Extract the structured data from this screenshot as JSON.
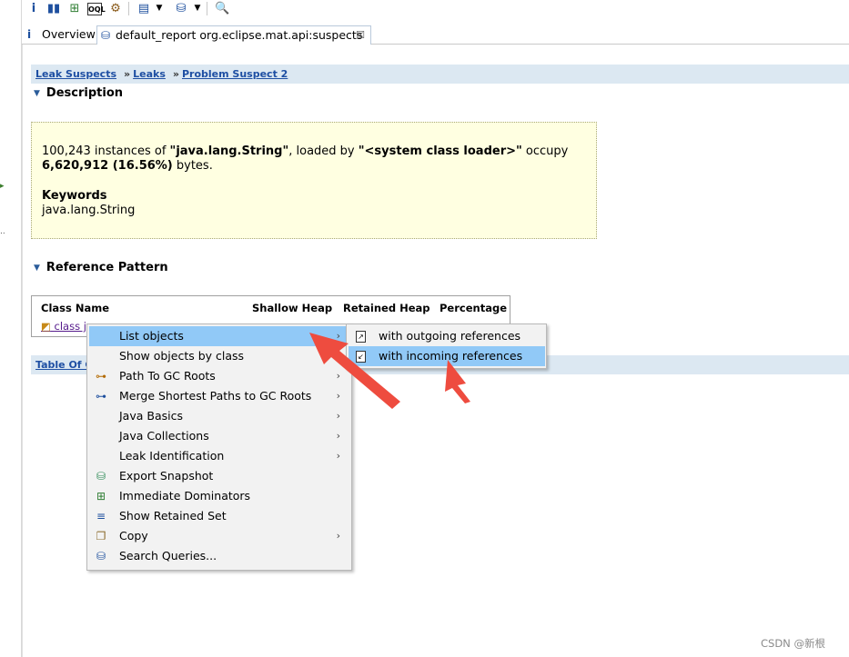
{
  "tabs": {
    "overview": "Overview",
    "report": "default_report  org.eclipse.mat.api:suspects",
    "close": "☒"
  },
  "breadcrumb": [
    "Leak Suspects",
    "Leaks",
    "Problem Suspect 2"
  ],
  "description": {
    "heading": "Description",
    "count": "100,243",
    "text1": " instances of ",
    "class_name": "\"java.lang.String\"",
    "text2": ", loaded by ",
    "loader": "\"<system class loader>\"",
    "text3": " occupy",
    "size": "6,620,912 (16.56%)",
    "text4": " bytes.",
    "keywords_title": "Keywords",
    "keywords": "java.lang.String"
  },
  "reference": {
    "heading": "Reference Pattern",
    "columns": [
      "Class Name",
      "Shallow Heap",
      "Retained Heap",
      "Percentage"
    ],
    "row_label": "class j"
  },
  "toc_link": "Table Of C",
  "context_menu": [
    {
      "label": "List objects",
      "icon": "",
      "submenu": true,
      "active": true
    },
    {
      "label": "Show objects by class",
      "icon": "",
      "submenu": false
    },
    {
      "label": "Path To GC Roots",
      "icon": "gc-path-icon",
      "submenu": true
    },
    {
      "label": "Merge Shortest Paths to GC Roots",
      "icon": "merge-paths-icon",
      "submenu": true
    },
    {
      "label": "Java Basics",
      "icon": "",
      "submenu": true
    },
    {
      "label": "Java Collections",
      "icon": "",
      "submenu": true
    },
    {
      "label": "Leak Identification",
      "icon": "",
      "submenu": true
    },
    {
      "label": "Export Snapshot",
      "icon": "export-snapshot-icon",
      "submenu": false
    },
    {
      "label": "Immediate Dominators",
      "icon": "dominators-icon",
      "submenu": false
    },
    {
      "label": "Show Retained Set",
      "icon": "retained-set-icon",
      "submenu": false
    },
    {
      "label": "Copy",
      "icon": "copy-icon",
      "submenu": true
    },
    {
      "label": "Search Queries...",
      "icon": "search-queries-icon",
      "submenu": false
    }
  ],
  "submenu": [
    {
      "label": "with outgoing references",
      "active": false
    },
    {
      "label": "with incoming references",
      "active": true
    }
  ],
  "watermark": "CSDN @新根",
  "colors": {
    "highlight": "#91c9f7",
    "desc_bg": "#ffffe1",
    "breadcrumb_bg": "#dce8f2",
    "annotation_arrow": "#ee4c3f",
    "link": "#1e4fa3"
  }
}
